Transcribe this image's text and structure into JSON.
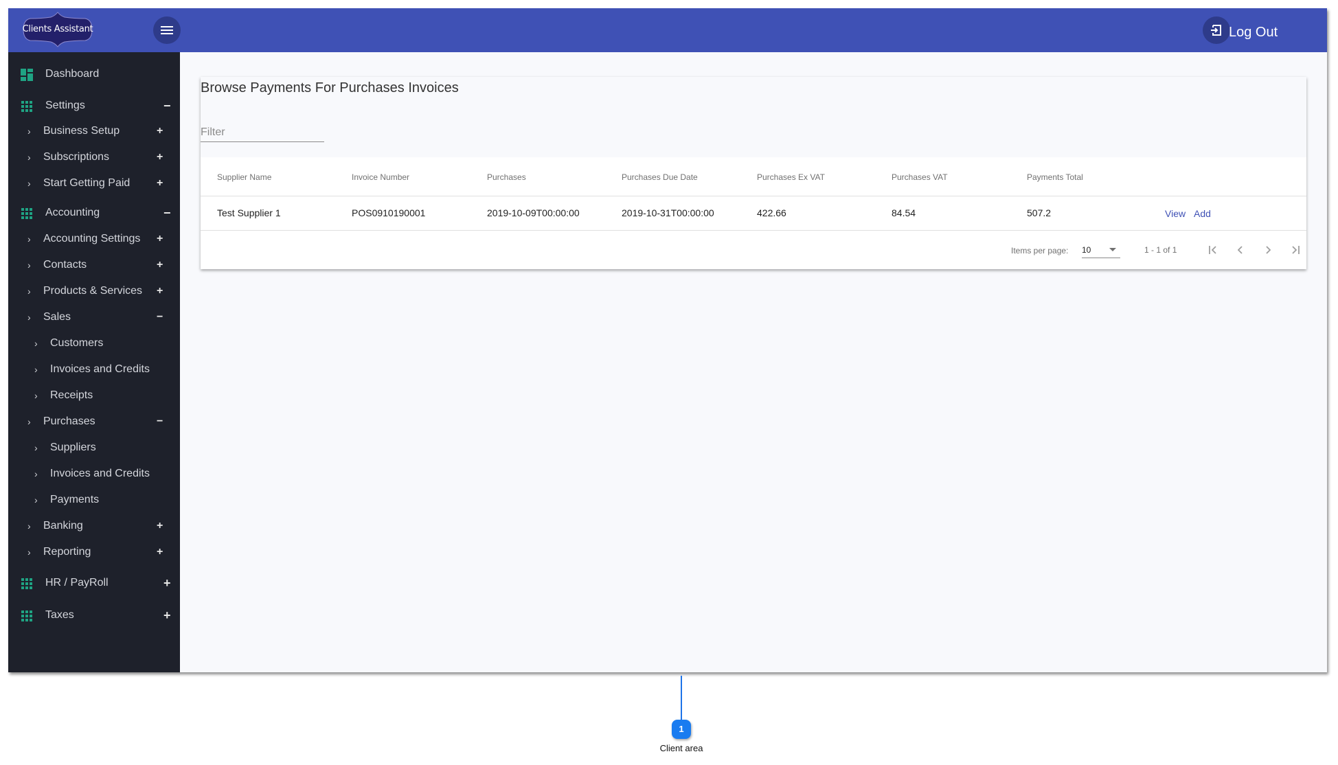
{
  "app": {
    "logo_text": "Clients Assistant",
    "logout_label": "Log Out",
    "colors": {
      "topbar": "#3f51b5",
      "sidebar": "#1e212b",
      "accent_icon": "#1fa383",
      "link": "#3f51b5",
      "callout": "#1a7cf0"
    }
  },
  "sidebar": {
    "items": [
      {
        "label": "Dashboard",
        "icon": "dashboard-icon",
        "level": 0,
        "toggle": ""
      },
      {
        "label": "Settings",
        "icon": "apps-grid-icon",
        "level": 0,
        "toggle": "−"
      },
      {
        "label": "Business Setup",
        "level": 1,
        "toggle": "+"
      },
      {
        "label": "Subscriptions",
        "level": 1,
        "toggle": "+"
      },
      {
        "label": "Start Getting Paid",
        "level": 1,
        "toggle": "+"
      },
      {
        "label": "Accounting",
        "icon": "apps-grid-icon",
        "level": 0,
        "toggle": "−"
      },
      {
        "label": "Accounting Settings",
        "level": 1,
        "toggle": "+"
      },
      {
        "label": "Contacts",
        "level": 1,
        "toggle": "+"
      },
      {
        "label": "Products & Services",
        "level": 1,
        "toggle": "+"
      },
      {
        "label": "Sales",
        "level": 1,
        "toggle": "−"
      },
      {
        "label": "Customers",
        "level": 2,
        "toggle": ""
      },
      {
        "label": "Invoices and Credits",
        "level": 2,
        "toggle": ""
      },
      {
        "label": "Receipts",
        "level": 2,
        "toggle": ""
      },
      {
        "label": "Purchases",
        "level": 1,
        "toggle": "−"
      },
      {
        "label": "Suppliers",
        "level": 2,
        "toggle": ""
      },
      {
        "label": "Invoices and Credits",
        "level": 2,
        "toggle": ""
      },
      {
        "label": "Payments",
        "level": 2,
        "toggle": ""
      },
      {
        "label": "Banking",
        "level": 1,
        "toggle": "+"
      },
      {
        "label": "Reporting",
        "level": 1,
        "toggle": "+"
      },
      {
        "label": "HR / PayRoll",
        "icon": "apps-grid-icon",
        "level": 0,
        "toggle": "+"
      },
      {
        "label": "Taxes",
        "icon": "apps-grid-icon",
        "level": 0,
        "toggle": "+"
      }
    ],
    "chevron": "›"
  },
  "main": {
    "title": "Browse Payments For Purchases Invoices",
    "filter": {
      "placeholder": "Filter",
      "value": ""
    },
    "table": {
      "columns": [
        "Supplier Name",
        "Invoice Number",
        "Purchases",
        "Purchases Due Date",
        "Purchases Ex VAT",
        "Purchases VAT",
        "Payments Total"
      ],
      "rows": [
        {
          "cells": [
            "Test Supplier 1",
            "POS0910190001",
            "2019-10-09T00:00:00",
            "2019-10-31T00:00:00",
            "422.66",
            "84.54",
            "507.2"
          ],
          "actions": [
            "View",
            "Add"
          ]
        }
      ]
    },
    "paginator": {
      "items_per_page_label": "Items per page:",
      "items_per_page": "10",
      "range_label": "1 - 1 of 1"
    }
  },
  "callout": {
    "number": "1",
    "label": "Client area"
  }
}
